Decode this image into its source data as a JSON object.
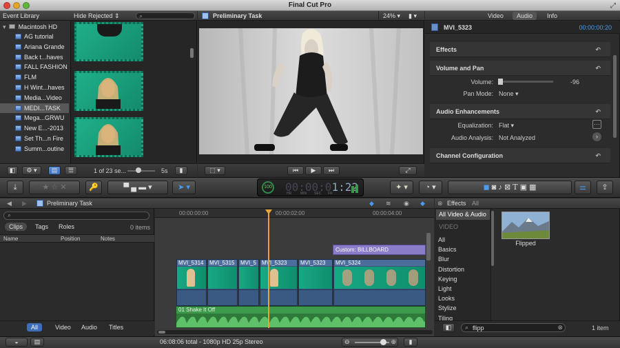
{
  "window": {
    "title": "Final Cut Pro"
  },
  "library": {
    "header": "Event Library",
    "disk": "Macintosh HD",
    "items": [
      "AG tutorial",
      "Ariana Grande",
      "Back t...haves",
      "FALL FASHION",
      "FLM",
      "H Wint...haves",
      "Media...Video",
      "MEDI...TASK",
      "Mega...GRWU",
      "New E...-2013",
      "Set Th...n Fire",
      "Summ...outine"
    ],
    "selected_index": 7
  },
  "browser": {
    "filter": "Hide Rejected",
    "search_placeholder": "",
    "count": "1 of 23 se...",
    "duration": "5s"
  },
  "viewer": {
    "title": "Preliminary Task",
    "zoom": "24%"
  },
  "inspector": {
    "tabs": [
      "Video",
      "Audio",
      "Info"
    ],
    "active_tab": "Audio",
    "clip_name": "MVI_5323",
    "timecode": "00:00:00:20",
    "sections": {
      "effects": "Effects",
      "volume_pan": "Volume and Pan",
      "audio_enh": "Audio Enhancements",
      "channel": "Channel Configuration"
    },
    "volume_label": "Volume:",
    "volume_value": "-96",
    "pan_label": "Pan Mode:",
    "pan_value": "None",
    "eq_label": "Equalization:",
    "eq_value": "Flat",
    "analysis_label": "Audio Analysis:",
    "analysis_value": "Not Analyzed"
  },
  "toolbar": {
    "timecode": "1:22",
    "percent": "100",
    "tc_labels": [
      "HR",
      "MIN",
      "SEC",
      "FR"
    ]
  },
  "timeline_index": {
    "project": "Preliminary Task",
    "tabs": [
      "Clips",
      "Tags",
      "Roles"
    ],
    "items_count": "0 items",
    "columns": [
      "Name",
      "Position",
      "Notes"
    ],
    "filters": [
      "All",
      "Video",
      "Audio",
      "Titles"
    ]
  },
  "timeline": {
    "ruler": [
      "00:00:00:00",
      "00:00:02:00",
      "00:00:04:00"
    ],
    "title_clip": "Custom: BILLBOARD",
    "clips": [
      "MVI_5314",
      "MVI_5315",
      "MVI_5",
      "MVI_5323",
      "MVI_5323",
      "MVI_5324"
    ],
    "audio_clip": "01 Shake It Off"
  },
  "effects": {
    "header": "Effects",
    "header_filter": "All",
    "categories_header": "All Video & Audio",
    "video_header": "VIDEO",
    "categories": [
      "All",
      "Basics",
      "Blur",
      "Distortion",
      "Keying",
      "Light",
      "Looks",
      "Stylize",
      "Tiling"
    ],
    "result_name": "Flipped",
    "search_value": "flipp",
    "count": "1 item"
  },
  "status": {
    "text": "06:08:06 total - 1080p HD 25p Stereo"
  },
  "colors": {
    "accent": "#3d8fe8",
    "playhead": "#e8a33a",
    "clip_green": "#18a884"
  }
}
